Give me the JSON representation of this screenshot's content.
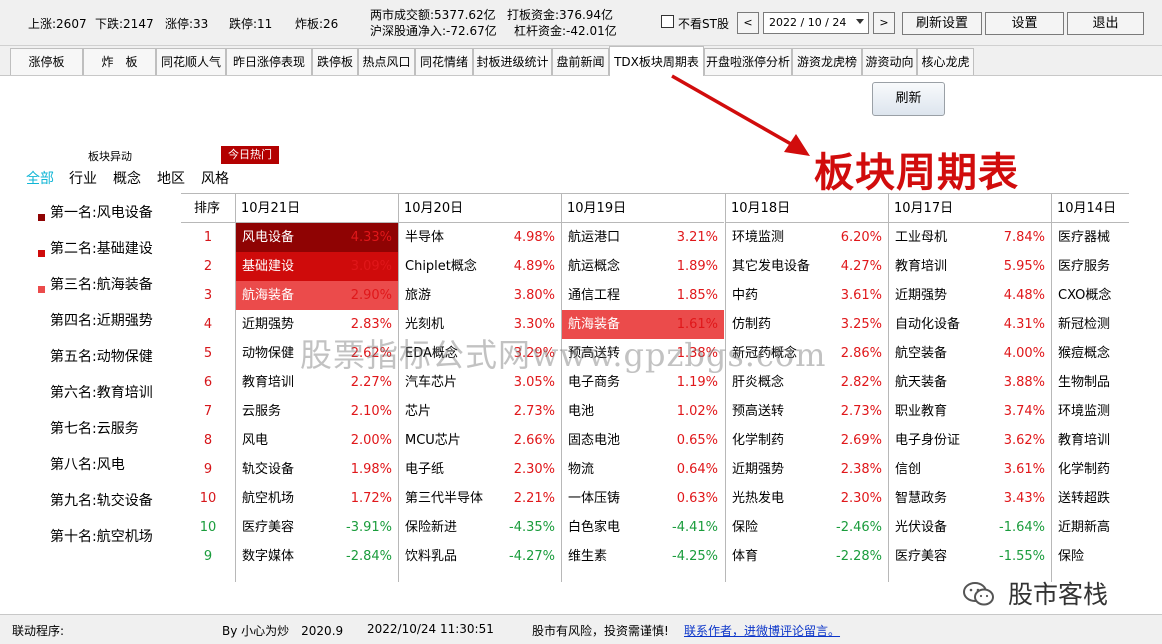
{
  "top_stats": {
    "up": "上涨:2607",
    "down": "下跌:2147",
    "limit_up": "涨停:33",
    "limit_down": "跌停:11",
    "broken": "炸板:26",
    "turnover": "两市成交额:5377.62亿",
    "hit_funds": "打板资金:376.94亿",
    "northbound": "沪深股通净入:-72.67亿",
    "leverage": "杠杆资金:-42.01亿"
  },
  "controls": {
    "hide_st_label": "不看ST股",
    "prev": "<",
    "next": ">",
    "date": "2022 / 10 / 24",
    "refresh_settings": "刷新设置",
    "settings": "设置",
    "exit": "退出"
  },
  "tabs": [
    "涨停板",
    "炸　板",
    "同花顺人气",
    "昨日涨停表现",
    "跌停板",
    "热点风口",
    "同花情绪",
    "封板进级统计",
    "盘前新闻",
    "TDX板块周期表",
    "开盘啦涨停分析",
    "游资龙虎榜",
    "游资动向",
    "核心龙虎"
  ],
  "active_tab": 9,
  "refresh_button": "刷新",
  "annotation_title": "板块周期表",
  "section": {
    "sector_move": "板块异动",
    "today_hot": "今日热门",
    "filters": [
      "全部",
      "行业",
      "概念",
      "地区",
      "风格"
    ]
  },
  "rankings": [
    "第一名:风电设备",
    "第二名:基础建设",
    "第三名:航海装备",
    "第四名:近期强势",
    "第五名:动物保健",
    "第六名:教育培训",
    "第七名:云服务",
    "第八名:风电",
    "第九名:轨交设备",
    "第十名:航空机场"
  ],
  "table": {
    "seq_header": "排序",
    "dates": [
      "10月21日",
      "10月20日",
      "10月19日",
      "10月18日",
      "10月17日",
      "10月14日"
    ],
    "rows": [
      {
        "seq": "1",
        "cells": [
          [
            "风电设备",
            "4.33%"
          ],
          [
            "半导体",
            "4.98%"
          ],
          [
            "航运港口",
            "3.21%"
          ],
          [
            "环境监测",
            "6.20%"
          ],
          [
            "工业母机",
            "7.84%"
          ],
          [
            "医疗器械",
            ""
          ]
        ]
      },
      {
        "seq": "2",
        "cells": [
          [
            "基础建设",
            "3.09%"
          ],
          [
            "Chiplet概念",
            "4.89%"
          ],
          [
            "航运概念",
            "1.89%"
          ],
          [
            "其它发电设备",
            "4.27%"
          ],
          [
            "教育培训",
            "5.95%"
          ],
          [
            "医疗服务",
            ""
          ]
        ]
      },
      {
        "seq": "3",
        "cells": [
          [
            "航海装备",
            "2.90%"
          ],
          [
            "旅游",
            "3.80%"
          ],
          [
            "通信工程",
            "1.85%"
          ],
          [
            "中药",
            "3.61%"
          ],
          [
            "近期强势",
            "4.48%"
          ],
          [
            "CXO概念",
            ""
          ]
        ]
      },
      {
        "seq": "4",
        "cells": [
          [
            "近期强势",
            "2.83%"
          ],
          [
            "光刻机",
            "3.30%"
          ],
          [
            "航海装备",
            "1.61%"
          ],
          [
            "仿制药",
            "3.25%"
          ],
          [
            "自动化设备",
            "4.31%"
          ],
          [
            "新冠检测",
            ""
          ]
        ]
      },
      {
        "seq": "5",
        "cells": [
          [
            "动物保健",
            "2.62%"
          ],
          [
            "EDA概念",
            "3.29%"
          ],
          [
            "预高送转",
            "1.38%"
          ],
          [
            "新冠药概念",
            "2.86%"
          ],
          [
            "航空装备",
            "4.00%"
          ],
          [
            "猴痘概念",
            ""
          ]
        ]
      },
      {
        "seq": "6",
        "cells": [
          [
            "教育培训",
            "2.27%"
          ],
          [
            "汽车芯片",
            "3.05%"
          ],
          [
            "电子商务",
            "1.19%"
          ],
          [
            "肝炎概念",
            "2.82%"
          ],
          [
            "航天装备",
            "3.88%"
          ],
          [
            "生物制品",
            ""
          ]
        ]
      },
      {
        "seq": "7",
        "cells": [
          [
            "云服务",
            "2.10%"
          ],
          [
            "芯片",
            "2.73%"
          ],
          [
            "电池",
            "1.02%"
          ],
          [
            "预高送转",
            "2.73%"
          ],
          [
            "职业教育",
            "3.74%"
          ],
          [
            "环境监测",
            ""
          ]
        ]
      },
      {
        "seq": "8",
        "cells": [
          [
            "风电",
            "2.00%"
          ],
          [
            "MCU芯片",
            "2.66%"
          ],
          [
            "固态电池",
            "0.65%"
          ],
          [
            "化学制药",
            "2.69%"
          ],
          [
            "电子身份证",
            "3.62%"
          ],
          [
            "教育培训",
            ""
          ]
        ]
      },
      {
        "seq": "9",
        "cells": [
          [
            "轨交设备",
            "1.98%"
          ],
          [
            "电子纸",
            "2.30%"
          ],
          [
            "物流",
            "0.64%"
          ],
          [
            "近期强势",
            "2.38%"
          ],
          [
            "信创",
            "3.61%"
          ],
          [
            "化学制药",
            ""
          ]
        ]
      },
      {
        "seq": "10",
        "cells": [
          [
            "航空机场",
            "1.72%"
          ],
          [
            "第三代半导体",
            "2.21%"
          ],
          [
            "一体压铸",
            "0.63%"
          ],
          [
            "光热发电",
            "2.30%"
          ],
          [
            "智慧政务",
            "3.43%"
          ],
          [
            "送转超跌",
            ""
          ]
        ]
      },
      {
        "seq": "10",
        "cells": [
          [
            "医疗美容",
            "-3.91%"
          ],
          [
            "保险新进",
            "-4.35%"
          ],
          [
            "白色家电",
            "-4.41%"
          ],
          [
            "保险",
            "-2.46%"
          ],
          [
            "光伏设备",
            "-1.64%"
          ],
          [
            "近期新高",
            ""
          ]
        ]
      },
      {
        "seq": "9",
        "cells": [
          [
            "数字媒体",
            "-2.84%"
          ],
          [
            "饮料乳品",
            "-4.27%"
          ],
          [
            "维生素",
            "-4.25%"
          ],
          [
            "体育",
            "-2.28%"
          ],
          [
            "医疗美容",
            "-1.55%"
          ],
          [
            "保险",
            ""
          ]
        ]
      }
    ]
  },
  "watermark": "股票指标公式网www.gpzbgs.com",
  "brand": "股市客栈",
  "statusbar": {
    "linkage": "联动程序:",
    "author": "By 小心为炒　2020.9",
    "time": "2022/10/24 11:30:51",
    "risk": "股市有风险，投资需谨慎!",
    "contact": "联系作者，进微博评论留言。"
  },
  "colors": {
    "rank1": "#8f0303",
    "rank2": "#cf0b0b",
    "rank3": "#eb4b4b",
    "up": "#e0171a",
    "down": "#1a9c3c",
    "seq_up": "#d6161a",
    "seq_down": "#1a9c3c",
    "filter_active": "#11b6d6",
    "annotation": "#d10c0c",
    "link": "#0b35c9"
  }
}
